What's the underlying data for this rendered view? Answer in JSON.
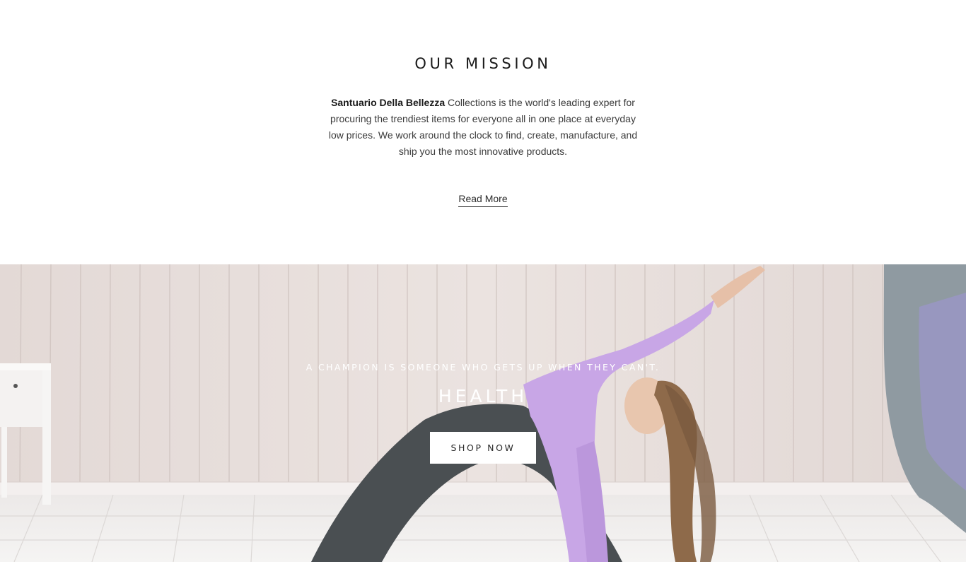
{
  "mission": {
    "title": "OUR MISSION",
    "brand": "Santuario Della Bellezza",
    "text": " Collections is the world's leading expert for procuring the trendiest items for everyone all in one place at everyday low prices. We work around the clock to find, create, manufacture, and ship you the most innovative products.",
    "read_more_label": "Read More"
  },
  "hero": {
    "tagline": "A CHAMPION IS SOMEONE WHO GETS UP WHEN THEY CAN'T.",
    "heading": "HEALTH",
    "button_label": "SHOP NOW"
  }
}
